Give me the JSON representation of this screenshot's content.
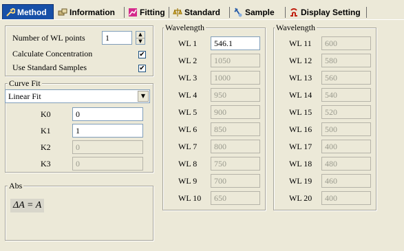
{
  "tabs": [
    {
      "label": "Method",
      "icon": "wrench-icon",
      "active": true
    },
    {
      "label": "Information",
      "icon": "info-icon",
      "active": false
    },
    {
      "label": "Fitting",
      "icon": "chart-icon",
      "active": false
    },
    {
      "label": "Standard",
      "icon": "standard-icon",
      "active": false
    },
    {
      "label": "Sample",
      "icon": "sample-icon",
      "active": false
    },
    {
      "label": "Display Setting",
      "icon": "display-icon",
      "active": false
    }
  ],
  "settings": {
    "num_wl_label": "Number of WL points",
    "num_wl_value": "1",
    "calc_conc_label": "Calculate Concentration",
    "calc_conc_checked": "✔",
    "use_std_label": "Use Standard Samples",
    "use_std_checked": "✔"
  },
  "curve_fit": {
    "legend": "Curve Fit",
    "method": "Linear Fit",
    "k": [
      {
        "label": "K0",
        "value": "0"
      },
      {
        "label": "K1",
        "value": "1"
      },
      {
        "label": "K2",
        "value": "0"
      },
      {
        "label": "K3",
        "value": "0"
      }
    ]
  },
  "abs": {
    "legend": "Abs",
    "formula": "ΔA = A"
  },
  "wavelength_left": {
    "legend": "Wavelength",
    "items": [
      {
        "label": "WL  1",
        "value": "546.1"
      },
      {
        "label": "WL  2",
        "value": "1050"
      },
      {
        "label": "WL  3",
        "value": "1000"
      },
      {
        "label": "WL  4",
        "value": "950"
      },
      {
        "label": "WL  5",
        "value": "900"
      },
      {
        "label": "WL  6",
        "value": "850"
      },
      {
        "label": "WL  7",
        "value": "800"
      },
      {
        "label": "WL  8",
        "value": "750"
      },
      {
        "label": "WL  9",
        "value": "700"
      },
      {
        "label": "WL 10",
        "value": "650"
      }
    ]
  },
  "wavelength_right": {
    "legend": "Wavelength",
    "items": [
      {
        "label": "WL 11",
        "value": "600"
      },
      {
        "label": "WL 12",
        "value": "580"
      },
      {
        "label": "WL 13",
        "value": "560"
      },
      {
        "label": "WL 14",
        "value": "540"
      },
      {
        "label": "WL 15",
        "value": "520"
      },
      {
        "label": "WL 16",
        "value": "500"
      },
      {
        "label": "WL 17",
        "value": "400"
      },
      {
        "label": "WL 18",
        "value": "480"
      },
      {
        "label": "WL 19",
        "value": "460"
      },
      {
        "label": "WL 20",
        "value": "400"
      }
    ]
  }
}
